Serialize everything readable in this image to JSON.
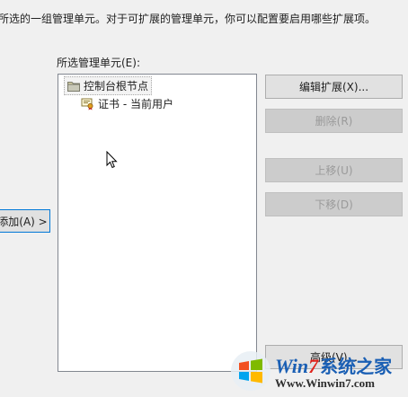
{
  "description": "所选的一组管理单元。对于可扩展的管理单元，你可以配置要启用哪些扩展项。",
  "selected_list": {
    "label": "所选管理单元(E):",
    "items": [
      {
        "label": "控制台根节点",
        "icon": "folder-icon"
      },
      {
        "label": "证书 - 当前用户",
        "icon": "certificate-icon"
      }
    ]
  },
  "buttons": {
    "add": "添加(A) >",
    "edit_extensions": "编辑扩展(X)...",
    "delete": "删除(R)",
    "move_up": "上移(U)",
    "move_down": "下移(D)",
    "advanced": "高级(V)..."
  },
  "watermark": {
    "brand_win": "Win",
    "brand_seven": "7",
    "brand_cn": "系统之家",
    "url": "Www.Winwin7.com"
  },
  "colors": {
    "accent": "#0078d7",
    "brand_blue": "#1a5fb4",
    "brand_red": "#e0231b"
  }
}
